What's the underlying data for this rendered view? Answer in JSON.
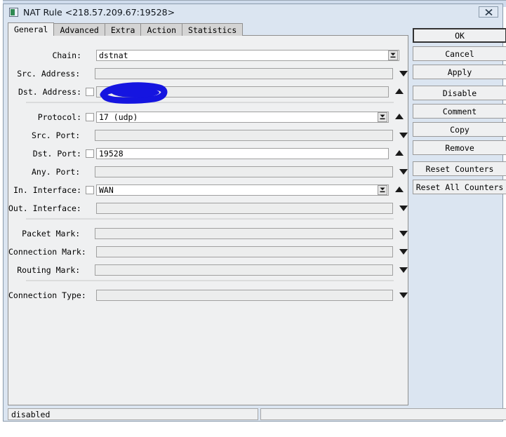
{
  "window": {
    "title": "NAT Rule <218.57.209.67:19528>",
    "icon": "app-window-icon",
    "close_label": "close-icon"
  },
  "tabs": [
    {
      "label": "General",
      "active": true
    },
    {
      "label": "Advanced",
      "active": false
    },
    {
      "label": "Extra",
      "active": false
    },
    {
      "label": "Action",
      "active": false
    },
    {
      "label": "Statistics",
      "active": false
    }
  ],
  "fields": [
    {
      "label": "Chain:",
      "value": "dstnat",
      "placeholder": "",
      "checkbox": false,
      "combo": true,
      "arrow": "none"
    },
    {
      "label": "Src. Address:",
      "value": "",
      "placeholder": "",
      "checkbox": false,
      "combo": false,
      "arrow": "down"
    },
    {
      "label": "Dst. Address:",
      "value": "",
      "placeholder": "",
      "checkbox": true,
      "combo": false,
      "arrow": "up",
      "redacted": true
    },
    {
      "label": "Protocol:",
      "value": "17 (udp)",
      "placeholder": "",
      "checkbox": true,
      "combo": true,
      "arrow": "up"
    },
    {
      "label": "Src. Port:",
      "value": "",
      "placeholder": "",
      "checkbox": false,
      "combo": false,
      "arrow": "down"
    },
    {
      "label": "Dst. Port:",
      "value": "19528",
      "placeholder": "",
      "checkbox": true,
      "combo": false,
      "arrow": "up"
    },
    {
      "label": "Any. Port:",
      "value": "",
      "placeholder": "",
      "checkbox": false,
      "combo": false,
      "arrow": "down"
    },
    {
      "label": "In. Interface:",
      "value": "WAN",
      "placeholder": "",
      "checkbox": true,
      "combo": true,
      "arrow": "up"
    },
    {
      "label": "Out. Interface:",
      "value": "",
      "placeholder": "",
      "checkbox": false,
      "combo": false,
      "arrow": "down"
    },
    {
      "label": "Packet Mark:",
      "value": "",
      "placeholder": "",
      "checkbox": false,
      "combo": false,
      "arrow": "down"
    },
    {
      "label": "Connection Mark:",
      "value": "",
      "placeholder": "",
      "checkbox": false,
      "combo": false,
      "arrow": "down"
    },
    {
      "label": "Routing Mark:",
      "value": "",
      "placeholder": "",
      "checkbox": false,
      "combo": false,
      "arrow": "down"
    },
    {
      "label": "Connection Type:",
      "value": "",
      "placeholder": "",
      "checkbox": false,
      "combo": false,
      "arrow": "down"
    }
  ],
  "buttons": [
    {
      "label": "OK",
      "default": true,
      "gap": false
    },
    {
      "label": "Cancel",
      "default": false,
      "gap": false
    },
    {
      "label": "Apply",
      "default": false,
      "gap": false
    },
    {
      "label": "Disable",
      "default": false,
      "gap": true
    },
    {
      "label": "Comment",
      "default": false,
      "gap": false
    },
    {
      "label": "Copy",
      "default": false,
      "gap": false
    },
    {
      "label": "Remove",
      "default": false,
      "gap": false
    },
    {
      "label": "Reset Counters",
      "default": false,
      "gap": true
    },
    {
      "label": "Reset All Counters",
      "default": false,
      "gap": false
    }
  ],
  "statusbar": {
    "left": "disabled",
    "right": ""
  },
  "colors": {
    "title_bg": "#dbe5f1",
    "panel_bg": "#eff0f1",
    "field_bg": "#ffffff",
    "field_disabled_bg": "#eceded",
    "border": "#9a9a9a",
    "redaction": "#1515e0"
  }
}
